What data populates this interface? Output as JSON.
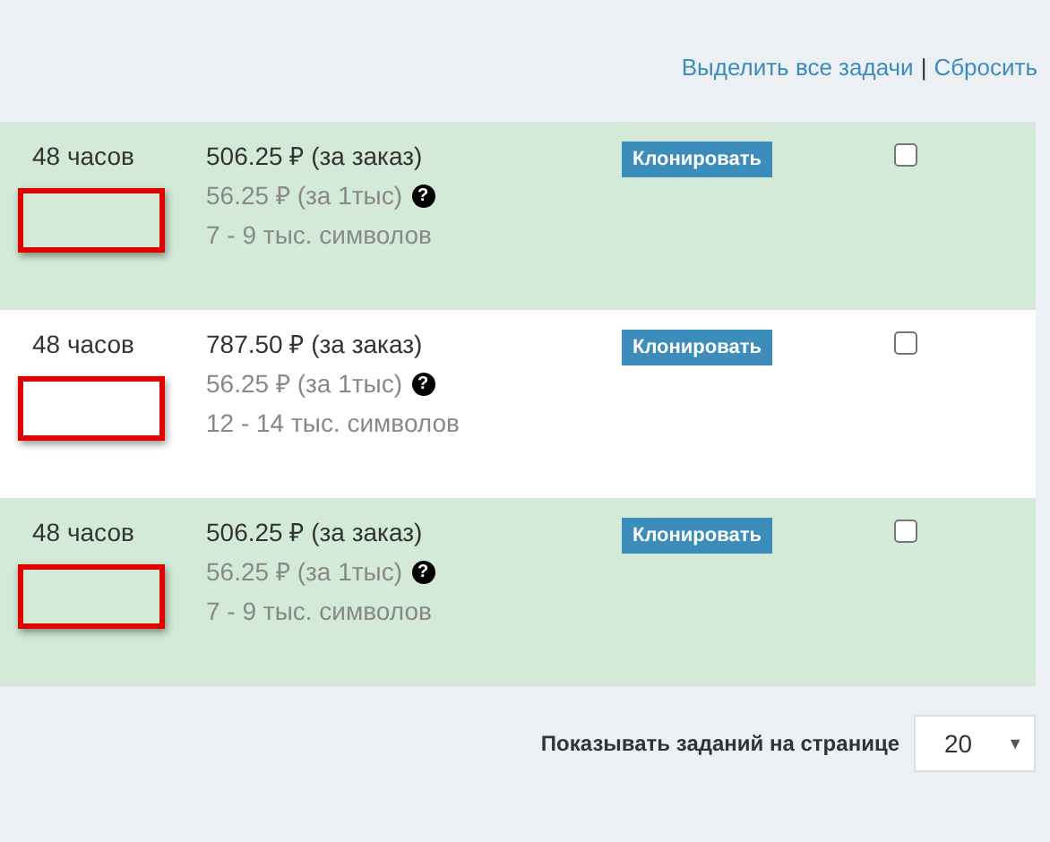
{
  "top_links": {
    "select_all": "Выделить все задачи",
    "separator": "|",
    "reset": "Сбросить"
  },
  "tasks": [
    {
      "highlighted": true,
      "deadline": "48 часов",
      "price": "506.25 ₽ (за заказ)",
      "rate": "56.25 ₽ (за 1тыс)",
      "help": "?",
      "volume": "7 - 9 тыс. символов",
      "clone_button": "Клонировать",
      "checked": false
    },
    {
      "highlighted": false,
      "deadline": "48 часов",
      "price": "787.50 ₽ (за заказ)",
      "rate": "56.25 ₽ (за 1тыс)",
      "help": "?",
      "volume": "12 - 14 тыс. символов",
      "clone_button": "Клонировать",
      "checked": false
    },
    {
      "highlighted": true,
      "deadline": "48 часов",
      "price": "506.25 ₽ (за заказ)",
      "rate": "56.25 ₽ (за 1тыс)",
      "help": "?",
      "volume": "7 - 9 тыс. символов",
      "clone_button": "Клонировать",
      "checked": false
    }
  ],
  "pager": {
    "label": "Показывать заданий на странице",
    "value": "20",
    "caret": "▼"
  }
}
